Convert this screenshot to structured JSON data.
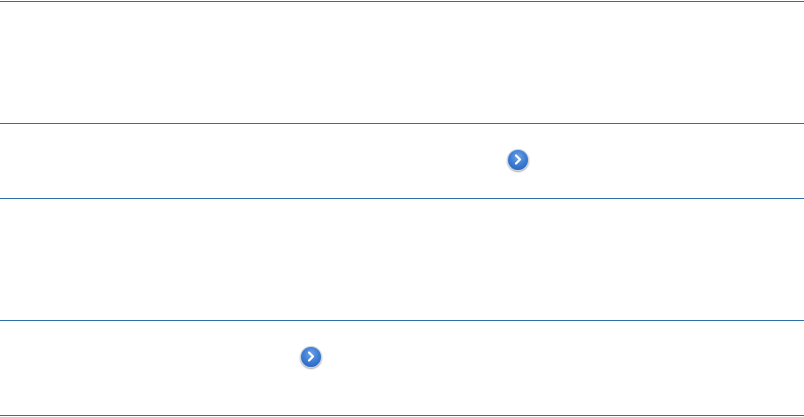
{
  "rows": [
    {
      "icon": "chevron-right-icon"
    },
    {
      "icon": "chevron-right-icon"
    }
  ],
  "colors": {
    "rule": "#2d6fa8",
    "disclosure_blue": "#3f7fd6",
    "background": "#ffffff"
  }
}
